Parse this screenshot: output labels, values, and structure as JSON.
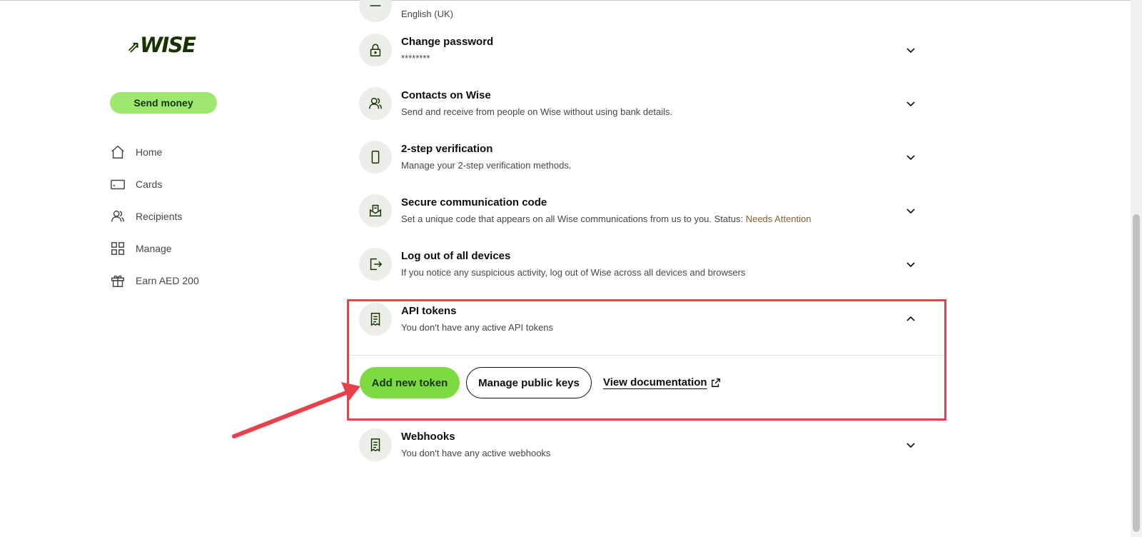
{
  "sidebar": {
    "logo": "WISE",
    "send_money": "Send money",
    "items": [
      {
        "label": "Home",
        "icon": "home-icon"
      },
      {
        "label": "Cards",
        "icon": "card-icon"
      },
      {
        "label": "Recipients",
        "icon": "recipients-icon"
      },
      {
        "label": "Manage",
        "icon": "grid-icon"
      },
      {
        "label": "Earn AED 200",
        "icon": "gift-icon"
      }
    ]
  },
  "settings": {
    "language": {
      "sub": "English (UK)"
    },
    "change_password": {
      "title": "Change password",
      "sub": "********"
    },
    "contacts": {
      "title": "Contacts on Wise",
      "sub": "Send and receive from people on Wise without using bank details."
    },
    "two_step": {
      "title": "2-step verification",
      "sub": "Manage your 2-step verification methods."
    },
    "secure_code": {
      "title": "Secure communication code",
      "sub": "Set a unique code that appears on all Wise communications from us to you. Status: ",
      "status": "Needs Attention"
    },
    "logout": {
      "title": "Log out of all devices",
      "sub": "If you notice any suspicious activity, log out of Wise across all devices and browsers"
    },
    "api_tokens": {
      "title": "API tokens",
      "sub": "You don't have any active API tokens",
      "add_button": "Add new token",
      "keys_button": "Manage public keys",
      "doc_link": "View documentation"
    },
    "webhooks": {
      "title": "Webhooks",
      "sub": "You don't have any active webhooks"
    }
  },
  "colors": {
    "brand_green": "#9fe870",
    "button_green": "#7ddb41",
    "brand_dark": "#163300",
    "highlight": "#e8414b",
    "attention": "#8a6130"
  }
}
